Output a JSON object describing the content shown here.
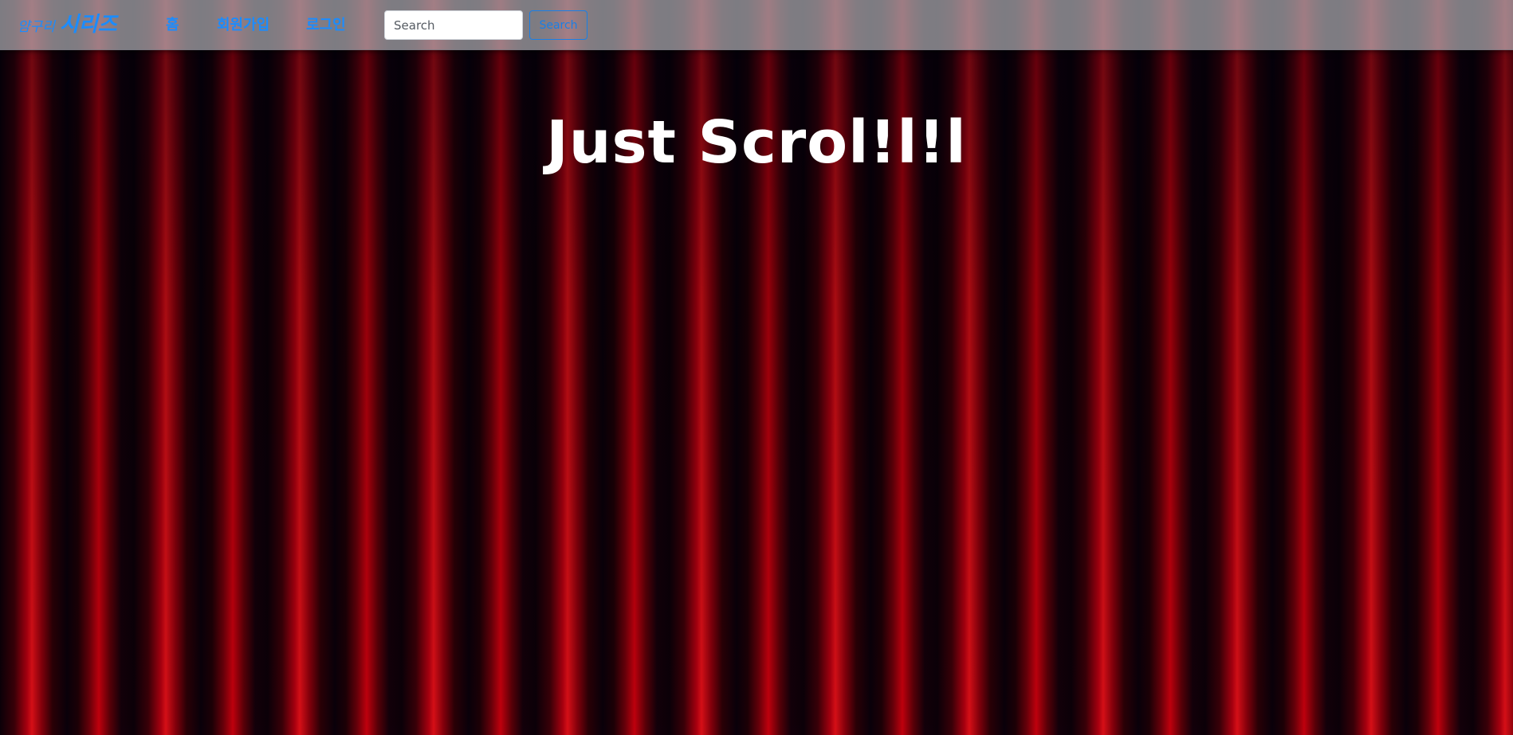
{
  "navbar": {
    "brand_small": "얌구리",
    "brand_large": "시리즈",
    "links": [
      {
        "label": "홈"
      },
      {
        "label": "회원가입"
      },
      {
        "label": "로그인"
      }
    ],
    "search": {
      "placeholder": "Search",
      "value": "",
      "button_label": "Search"
    },
    "accent_color": "#1a8cff"
  },
  "main": {
    "title": "Just Scrol!l!l",
    "background": "red-curtain"
  }
}
